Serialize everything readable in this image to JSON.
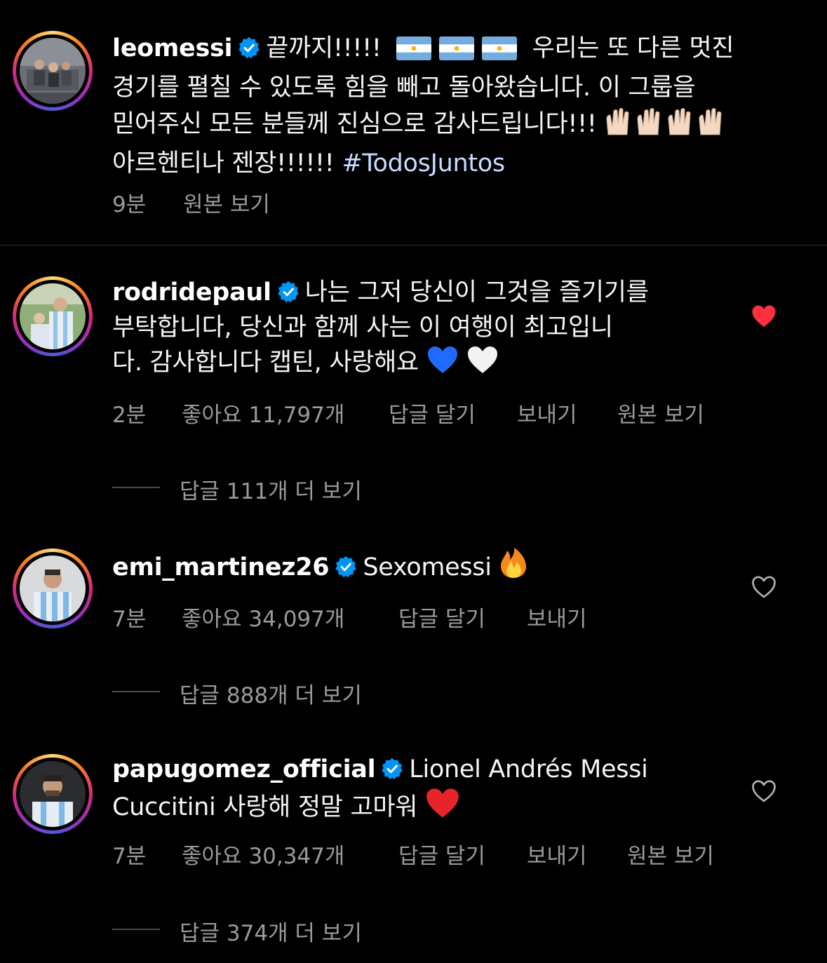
{
  "caption": {
    "username": "leomessi",
    "text_part1": "끝까지!!!!!",
    "flags": [
      "🇦🇷",
      "🇦🇷",
      "🇦🇷"
    ],
    "text_part2": "우리는 또 다른 멋진",
    "line2": "경기를 펼칠 수 있도록 힘을 빼고 돌아왔습니다. 이 그룹을",
    "line3": "믿어주신 모든 분들께 진심으로 감사드립니다!!!",
    "line3_emoji": "🙌🏻🙌🏻🙌🏻🙌🏻",
    "line4_text": "아르헨티나 젠장!!!!!!",
    "hashtag": "#TodosJuntos",
    "time": "9분",
    "see_translation": "원본 보기"
  },
  "comments": [
    {
      "username": "rodridepaul",
      "line1": "나는 그저 당신이 그것을 즐기기를",
      "line2": "부탁합니다, 당신과 함께 사는 이 여행이 최고입니",
      "line3": "다. 감사합니다 캡틴, 사랑해요",
      "line3_emoji": "💙🤍",
      "time": "2분",
      "likes": "좋아요 11,797개",
      "reply": "답글 달기",
      "send": "보내기",
      "see_translation": "원본 보기",
      "view_replies": "답글 111개 더 보기",
      "liked": true
    },
    {
      "username": "emi_martinez26",
      "line1": "Sexomessi",
      "line1_emoji": "🔥",
      "time": "7분",
      "likes": "좋아요 34,097개",
      "reply": "답글 달기",
      "send": "보내기",
      "view_replies": "답글 888개 더 보기",
      "liked": false
    },
    {
      "username": "papugomez_official",
      "line1": "Lionel Andrés Messi",
      "line2": "Cuccitini 사랑해 정말 고마워",
      "line2_emoji": "❤️",
      "time": "7분",
      "likes": "좋아요 30,347개",
      "reply": "답글 달기",
      "send": "보내기",
      "see_translation": "원본 보기",
      "view_replies": "답글 374개 더 보기",
      "liked": false
    }
  ],
  "colors": {
    "background": "#000000",
    "text": "#f5f5f5",
    "secondary_text": "#9a9a9a",
    "verified_blue": "#0095f6",
    "liked_heart": "#ff3040",
    "hashtag": "#c7dcff"
  },
  "icons": {
    "verified": "verified-badge-icon",
    "heart_filled": "heart-filled-icon",
    "heart_outline": "heart-outline-icon"
  }
}
